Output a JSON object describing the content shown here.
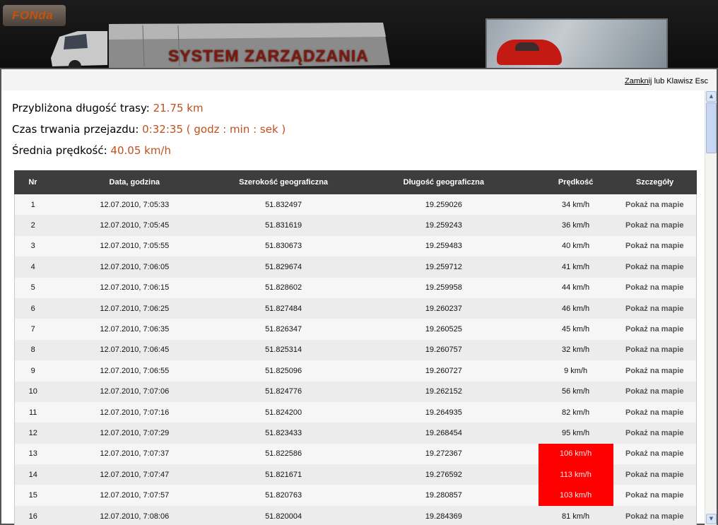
{
  "header": {
    "logo_text": "FONda",
    "system_title": "SYSTEM ZARZĄDZANIA"
  },
  "modal": {
    "close_label": "Zamknij",
    "close_hint": " lub Klawisz Esc"
  },
  "summary": {
    "distance_label": "Przybliżona długość trasy:",
    "distance_value": "21.75 km",
    "duration_label": "Czas trwania przejazdu:",
    "duration_value": "0:32:35 ( godz : min : sek )",
    "avg_speed_label": "Średnia prędkość:",
    "avg_speed_value": "40.05 km/h"
  },
  "table": {
    "columns": [
      "Nr",
      "Data, godzina",
      "Szerokość geograficzna",
      "Długość geograficzna",
      "Prędkość",
      "Szczegóły"
    ],
    "rows": [
      {
        "nr": "1",
        "datetime": "12.07.2010, 7:05:33",
        "lat": "51.832497",
        "lon": "19.259026",
        "speed": "34 km/h",
        "link": "Pokaż na mapie",
        "highlight": false
      },
      {
        "nr": "2",
        "datetime": "12.07.2010, 7:05:45",
        "lat": "51.831619",
        "lon": "19.259243",
        "speed": "36 km/h",
        "link": "Pokaż na mapie",
        "highlight": false
      },
      {
        "nr": "3",
        "datetime": "12.07.2010, 7:05:55",
        "lat": "51.830673",
        "lon": "19.259483",
        "speed": "40 km/h",
        "link": "Pokaż na mapie",
        "highlight": false
      },
      {
        "nr": "4",
        "datetime": "12.07.2010, 7:06:05",
        "lat": "51.829674",
        "lon": "19.259712",
        "speed": "41 km/h",
        "link": "Pokaż na mapie",
        "highlight": false
      },
      {
        "nr": "5",
        "datetime": "12.07.2010, 7:06:15",
        "lat": "51.828602",
        "lon": "19.259958",
        "speed": "44 km/h",
        "link": "Pokaż na mapie",
        "highlight": false
      },
      {
        "nr": "6",
        "datetime": "12.07.2010, 7:06:25",
        "lat": "51.827484",
        "lon": "19.260237",
        "speed": "46 km/h",
        "link": "Pokaż na mapie",
        "highlight": false
      },
      {
        "nr": "7",
        "datetime": "12.07.2010, 7:06:35",
        "lat": "51.826347",
        "lon": "19.260525",
        "speed": "45 km/h",
        "link": "Pokaż na mapie",
        "highlight": false
      },
      {
        "nr": "8",
        "datetime": "12.07.2010, 7:06:45",
        "lat": "51.825314",
        "lon": "19.260757",
        "speed": "32 km/h",
        "link": "Pokaż na mapie",
        "highlight": false
      },
      {
        "nr": "9",
        "datetime": "12.07.2010, 7:06:55",
        "lat": "51.825096",
        "lon": "19.260727",
        "speed": "9 km/h",
        "link": "Pokaż na mapie",
        "highlight": false
      },
      {
        "nr": "10",
        "datetime": "12.07.2010, 7:07:06",
        "lat": "51.824776",
        "lon": "19.262152",
        "speed": "56 km/h",
        "link": "Pokaż na mapie",
        "highlight": false
      },
      {
        "nr": "11",
        "datetime": "12.07.2010, 7:07:16",
        "lat": "51.824200",
        "lon": "19.264935",
        "speed": "82 km/h",
        "link": "Pokaż na mapie",
        "highlight": false
      },
      {
        "nr": "12",
        "datetime": "12.07.2010, 7:07:29",
        "lat": "51.823433",
        "lon": "19.268454",
        "speed": "95 km/h",
        "link": "Pokaż na mapie",
        "highlight": false
      },
      {
        "nr": "13",
        "datetime": "12.07.2010, 7:07:37",
        "lat": "51.822586",
        "lon": "19.272367",
        "speed": "106 km/h",
        "link": "Pokaż na mapie",
        "highlight": true
      },
      {
        "nr": "14",
        "datetime": "12.07.2010, 7:07:47",
        "lat": "51.821671",
        "lon": "19.276592",
        "speed": "113 km/h",
        "link": "Pokaż na mapie",
        "highlight": true
      },
      {
        "nr": "15",
        "datetime": "12.07.2010, 7:07:57",
        "lat": "51.820763",
        "lon": "19.280857",
        "speed": "103 km/h",
        "link": "Pokaż na mapie",
        "highlight": true
      },
      {
        "nr": "16",
        "datetime": "12.07.2010, 7:08:06",
        "lat": "51.820004",
        "lon": "19.284369",
        "speed": "81 km/h",
        "link": "Pokaż na mapie",
        "highlight": false
      }
    ]
  },
  "colors": {
    "value_accent": "#c0501e",
    "speed_alert": "#ff0000",
    "table_header": "#3d3d3d"
  },
  "icons": {
    "scroll_up": "triangle-up-icon",
    "scroll_down": "triangle-down-icon"
  }
}
